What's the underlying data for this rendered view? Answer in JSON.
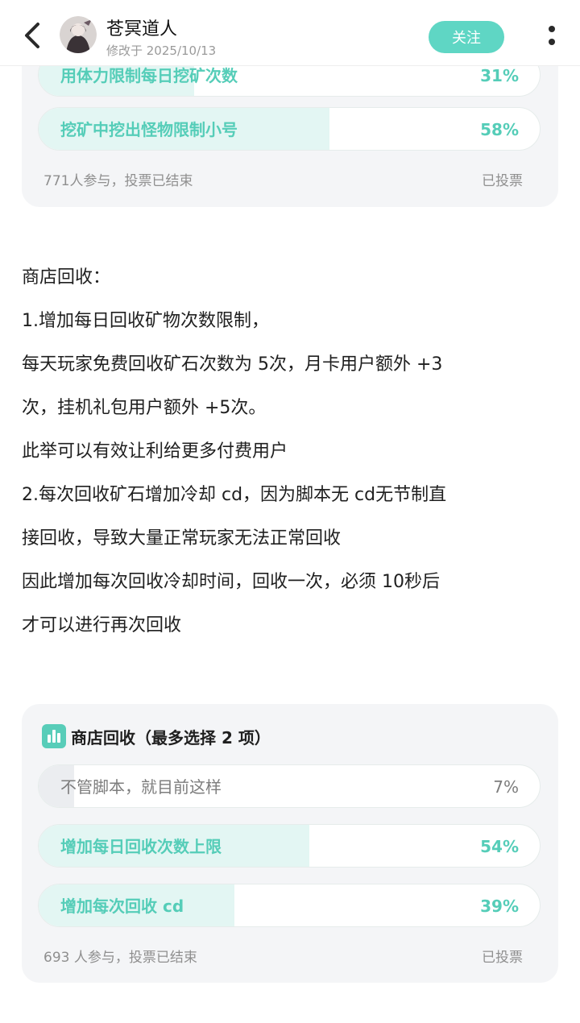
{
  "header": {
    "author": "苍冥道人",
    "modified": "修改于 2025/10/13",
    "follow_label": "关注"
  },
  "poll1": {
    "options": [
      {
        "label": "用体力限制每日挖矿次数",
        "pct": "31%",
        "value": 31,
        "selected": true
      },
      {
        "label": "挖矿中挖出怪物限制小号",
        "pct": "58%",
        "value": 58,
        "selected": true
      }
    ],
    "participants": "771人参与，投票已结束",
    "status": "已投票"
  },
  "post": {
    "lines": [
      "商店回收：",
      "1.增加每日回收矿物次数限制，",
      "每天玩家免费回收矿石次数为 5次，月卡用户额外 +3",
      "次，挂机礼包用户额外 +5次。",
      "此举可以有效让利给更多付费用户",
      "2.每次回收矿石增加冷却 cd，因为脚本无 cd无节制直",
      "接回收，导致大量正常玩家无法正常回收",
      "因此增加每次回收冷却时间，回收一次，必须 10秒后",
      "才可以进行再次回收"
    ]
  },
  "poll2": {
    "title": "商店回收（最多选择 2 项）",
    "options": [
      {
        "label": "不管脚本，就目前这样",
        "pct": "7%",
        "value": 7,
        "selected": false
      },
      {
        "label": "增加每日回收次数上限",
        "pct": "54%",
        "value": 54,
        "selected": true
      },
      {
        "label": "增加每次回收 cd",
        "pct": "39%",
        "value": 39,
        "selected": true
      }
    ],
    "participants": "693 人参与，投票已结束",
    "status": "已投票"
  },
  "colors": {
    "accent": "#5fd6c4",
    "selected_text": "#55cdb8",
    "selected_fill": "#e3f6f3",
    "card_bg": "#f4f5f7"
  },
  "icons": [
    "back-chevron-icon",
    "more-vertical-icon",
    "poll-chart-icon"
  ]
}
